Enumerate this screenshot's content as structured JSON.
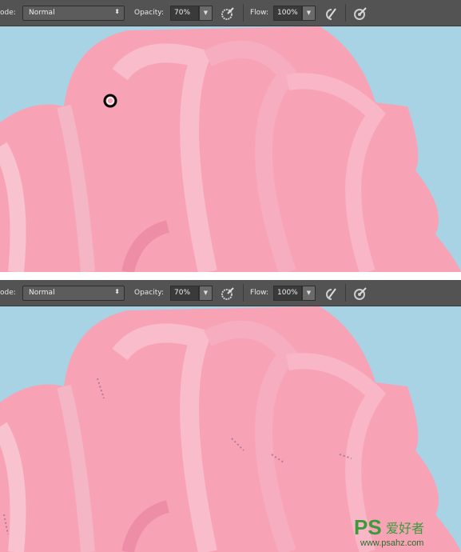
{
  "toolbars": [
    {
      "mode_label": "ode:",
      "mode_value": "Normal",
      "opacity_label": "Opacity:",
      "opacity_value": "70%",
      "flow_label": "Flow:",
      "flow_value": "100%"
    },
    {
      "mode_label": "ode:",
      "mode_value": "Normal",
      "opacity_label": "Opacity:",
      "opacity_value": "70%",
      "flow_label": "Flow:",
      "flow_value": "100%"
    }
  ],
  "colors": {
    "toolbar": "#535353",
    "background": "#a8d3e5",
    "cream": "#f7a3b5"
  },
  "watermark": {
    "logo": "PS爱好者",
    "url": "www.psahz.com"
  }
}
